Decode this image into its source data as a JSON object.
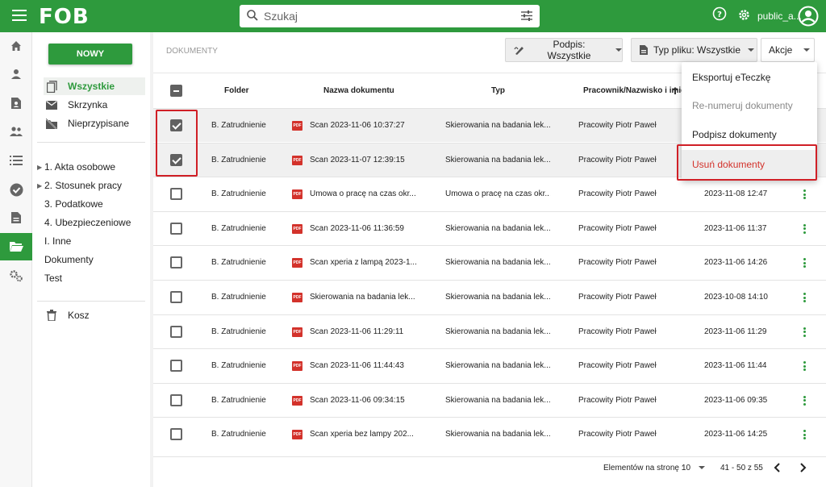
{
  "app": {
    "logo": "FOB",
    "username": "public_a..."
  },
  "search": {
    "placeholder": "Szukaj"
  },
  "icons": {
    "menu": "hamburger-icon",
    "search": "search-icon",
    "filter": "sliders-icon",
    "help": "help-icon",
    "settings": "gear-icon",
    "account": "account-circle-icon"
  },
  "colors": {
    "brand": "#2e9a3d",
    "danger": "#d3322b",
    "highlight": "#d01f26"
  },
  "rail": [
    "home-icon",
    "person-icon",
    "document-user-icon",
    "group-icon",
    "list-icon",
    "check-circle-icon",
    "document-icon",
    "folder-open-icon",
    "cogs-icon"
  ],
  "sidebar": {
    "new_button": "NOWY",
    "nav": [
      {
        "label": "Wszystkie",
        "icon": "documents-icon"
      },
      {
        "label": "Skrzynka",
        "icon": "mail-icon"
      },
      {
        "label": "Nieprzypisane",
        "icon": "unassigned-icon"
      }
    ],
    "tree": [
      {
        "label": "1. Akta osobowe",
        "expandable": true
      },
      {
        "label": "2. Stosunek pracy",
        "expandable": true
      },
      {
        "label": "3. Podatkowe",
        "expandable": false
      },
      {
        "label": "4. Ubezpieczeniowe",
        "expandable": false
      },
      {
        "label": "I. Inne",
        "expandable": false
      },
      {
        "label": "Dokumenty",
        "expandable": false
      },
      {
        "label": "Test",
        "expandable": false
      }
    ],
    "trash": "Kosz"
  },
  "main": {
    "breadcrumb": "DOKUMENTY",
    "filters": {
      "podpis": "Podpis: Wszystkie",
      "typ_pliku": "Typ pliku: Wszystkie",
      "akcje": "Akcje"
    },
    "columns": {
      "folder": "Folder",
      "name": "Nazwa dokumentu",
      "type": "Typ",
      "employee": "Pracownik/Nazwisko i imię"
    },
    "rows": [
      {
        "checked": true,
        "folder": "B. Zatrudnienie",
        "name": "Scan 2023-11-06 10:37:27",
        "type": "Skierowania na badania lek...",
        "employee": "Pracowity Piotr Paweł",
        "date": ""
      },
      {
        "checked": true,
        "folder": "B. Zatrudnienie",
        "name": "Scan 2023-11-07 12:39:15",
        "type": "Skierowania na badania lek...",
        "employee": "Pracowity Piotr Paweł",
        "date": ""
      },
      {
        "checked": false,
        "folder": "B. Zatrudnienie",
        "name": "Umowa o pracę na czas okr...",
        "type": "Umowa o pracę na czas okr...",
        "employee": "Pracowity Piotr Paweł",
        "date": "2023-11-08 12:47"
      },
      {
        "checked": false,
        "folder": "B. Zatrudnienie",
        "name": "Scan 2023-11-06 11:36:59",
        "type": "Skierowania na badania lek...",
        "employee": "Pracowity Piotr Paweł",
        "date": "2023-11-06 11:37"
      },
      {
        "checked": false,
        "folder": "B. Zatrudnienie",
        "name": "Scan xperia z lampą 2023-1...",
        "type": "Skierowania na badania lek...",
        "employee": "Pracowity Piotr Paweł",
        "date": "2023-11-06 14:26"
      },
      {
        "checked": false,
        "folder": "B. Zatrudnienie",
        "name": "Skierowania na badania lek...",
        "type": "Skierowania na badania lek...",
        "employee": "Pracowity Piotr Paweł",
        "date": "2023-10-08 14:10"
      },
      {
        "checked": false,
        "folder": "B. Zatrudnienie",
        "name": "Scan 2023-11-06 11:29:11",
        "type": "Skierowania na badania lek...",
        "employee": "Pracowity Piotr Paweł",
        "date": "2023-11-06 11:29"
      },
      {
        "checked": false,
        "folder": "B. Zatrudnienie",
        "name": "Scan 2023-11-06 11:44:43",
        "type": "Skierowania na badania lek...",
        "employee": "Pracowity Piotr Paweł",
        "date": "2023-11-06 11:44"
      },
      {
        "checked": false,
        "folder": "B. Zatrudnienie",
        "name": "Scan 2023-11-06 09:34:15",
        "type": "Skierowania na badania lek...",
        "employee": "Pracowity Piotr Paweł",
        "date": "2023-11-06 09:35"
      },
      {
        "checked": false,
        "folder": "B. Zatrudnienie",
        "name": "Scan xperia bez lampy 202...",
        "type": "Skierowania na badania lek...",
        "employee": "Pracowity Piotr Paweł",
        "date": "2023-11-06 14:25"
      }
    ],
    "file_badge": "PDF",
    "pagination": {
      "per_page_label": "Elementów na stronę :",
      "per_page": "10",
      "range": "41 - 50 z 55"
    }
  },
  "actions_menu": [
    {
      "label": "Eksportuj eTeczkę",
      "state": "normal"
    },
    {
      "label": "Re-numeruj dokumenty",
      "state": "disabled"
    },
    {
      "label": "Podpisz dokumenty",
      "state": "normal"
    },
    {
      "label": "Usuń dokumenty",
      "state": "danger"
    }
  ]
}
